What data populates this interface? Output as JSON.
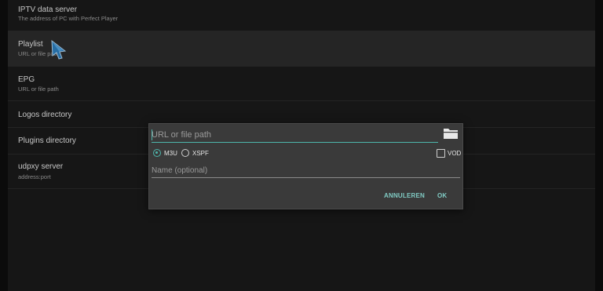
{
  "settings": {
    "items": [
      {
        "title": "IPTV data server",
        "subtitle": "The address of PC with Perfect Player"
      },
      {
        "title": "Playlist",
        "subtitle": "URL or file path"
      },
      {
        "title": "EPG",
        "subtitle": "URL or file path"
      },
      {
        "title": "Logos directory",
        "subtitle": ""
      },
      {
        "title": "Plugins directory",
        "subtitle": ""
      },
      {
        "title": "udpxy server",
        "subtitle": "address:port"
      }
    ],
    "selected_item": "Playlist"
  },
  "dialog": {
    "url_placeholder": "URL or file path",
    "formats": [
      {
        "label": "M3U",
        "selected": true
      },
      {
        "label": "XSPF",
        "selected": false
      }
    ],
    "vod_label": "VOD",
    "vod_checked": false,
    "name_placeholder": "Name (optional)",
    "cancel_label": "ANNULEREN",
    "ok_label": "OK"
  },
  "colors": {
    "accent": "#4db6ac",
    "button_text": "#80cbc4",
    "dialog_bg": "#3a3a3a"
  },
  "icons": {
    "folder": "folder-icon",
    "cursor": "pointer-cursor-icon"
  }
}
